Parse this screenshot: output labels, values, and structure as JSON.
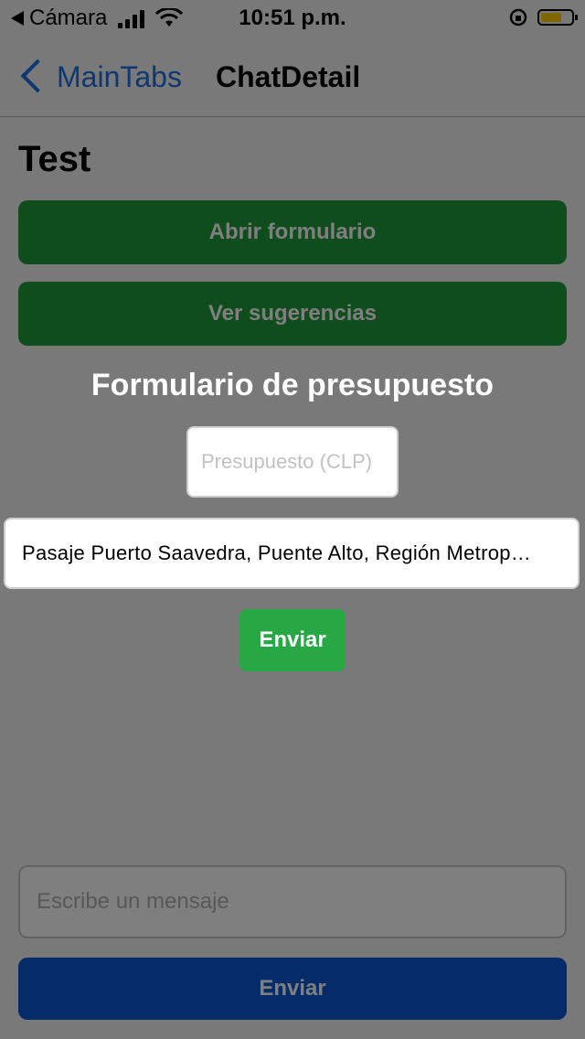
{
  "status_bar": {
    "back_app": "Cámara",
    "time": "10:51 p.m.",
    "battery_color": "#ffcc00"
  },
  "nav": {
    "back_label": "MainTabs",
    "title": "ChatDetail"
  },
  "chat": {
    "title": "Test",
    "open_form_label": "Abrir formulario",
    "suggestions_label": "Ver sugerencias",
    "message_placeholder": "Escribe un mensaje",
    "send_label": "Enviar"
  },
  "modal": {
    "title": "Formulario de presupuesto",
    "budget_placeholder": "Presupuesto (CLP)",
    "address_value": "Pasaje Puerto Saavedra, Puente Alto, Región Metrop…",
    "send_label": "Enviar"
  },
  "colors": {
    "accent": "#1f6fe0",
    "green_button": "#1f9a3b",
    "blue_button": "#0a58d0",
    "modal_send": "#28a745"
  }
}
